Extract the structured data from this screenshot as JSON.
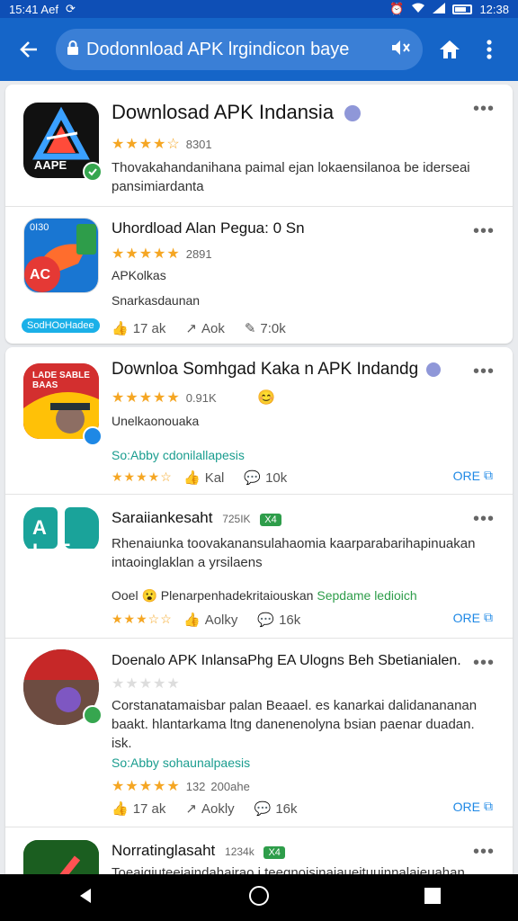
{
  "status": {
    "left": "15:41 Aef",
    "time": "12:38"
  },
  "app_bar": {
    "url": "Dodonnload APK lrgindicon baye"
  },
  "cards": [
    {
      "title": "Downlosad APK Indansia",
      "icon_text": "AAPE",
      "rating_count": "8301",
      "desc": "Thovakahandanihana paimal ejan lokaensilanoa be iderseai pansimiardanta"
    },
    {
      "title": "Uhordload Alan Pegua: 0 Sn",
      "rating_count": "2891",
      "line1": "APKolkas",
      "line2": "Snarkasdaunan",
      "chip": "SodHOoHadee",
      "icon_text_top": "0I30",
      "icon_text_ap": "AC",
      "actions": [
        "17 ak",
        "Aok",
        "7:0k"
      ]
    },
    {
      "title": "Downloa Somhgad Kaka n APK Indandg",
      "rating_count": "0.91K",
      "sub": "Unelkaonouaka",
      "tag": "So:Abby cdonilallapesis",
      "actions": [
        "Kal",
        "10k"
      ],
      "open": "ORE",
      "icon_banner": "LADE SABLE BAAS"
    },
    {
      "title": "Saraiiankesaht",
      "meta": "725IK",
      "pill": "X4",
      "desc": "Rhenaiunka toovakanansulahaomia kaarparabarihapinuakan intaoinglaklan a yrsilaens",
      "note": "Ooel",
      "note2": "Plenarpenhadekritaiouskan",
      "note3": "Sepdame ledioich",
      "actions": [
        "Aolky",
        "16k"
      ],
      "open": "ORE",
      "icon_letters": "A IE"
    },
    {
      "title": "Doenalo APK InlansaPhg EA Ulogns Beh",
      "title_tail": "Sbetianialen.",
      "desc": "Corstanatamaisbar palan Beaael. es kanarkai dalidanananan baakt. hlantarkama ltng danenenolyna bsian paenar duadan. isk.",
      "tag": "So:Abby sohaunalpaesis",
      "rating_count": "132",
      "rating_text": "200ahe",
      "actions": [
        "17 ak",
        "Aokly",
        "16k"
      ],
      "open": "ORE"
    },
    {
      "title": "Norratinglasaht",
      "meta": "1234k",
      "pill": "X4",
      "desc": "Toeaigiuteeiaindahairao i teegnoisinaiaueituuinnalaieuahan"
    }
  ],
  "colors": {
    "accent": "#1565c8",
    "star": "#f5a623",
    "link": "#1e88e5",
    "green": "#36a64f"
  }
}
